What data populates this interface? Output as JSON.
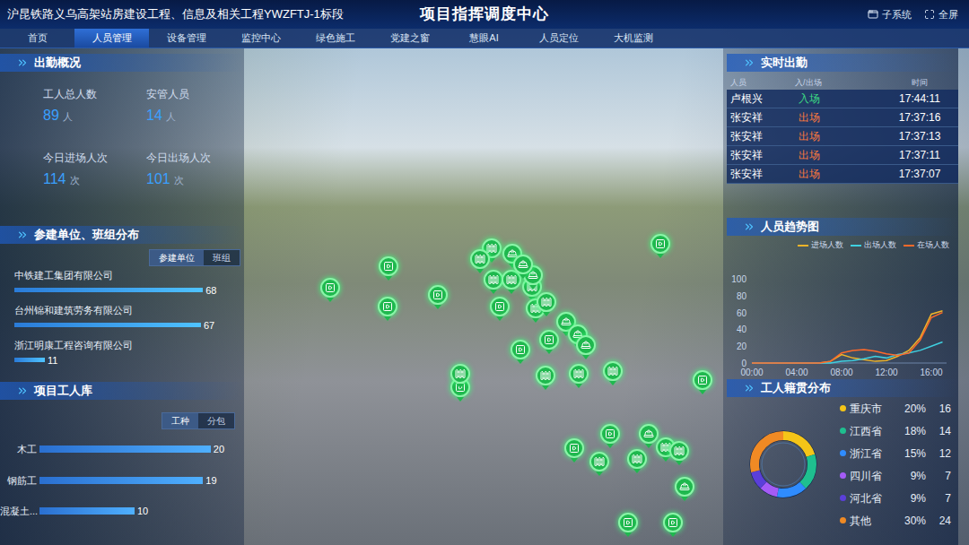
{
  "header": {
    "project": "沪昆铁路义乌高架站房建设工程、信息及相关工程YWZFTJ-1标段",
    "title": "项目指挥调度中心",
    "buttons": [
      {
        "label": "子系统",
        "kind": "subsystem"
      },
      {
        "label": "全屏",
        "kind": "fullscreen"
      }
    ]
  },
  "nav": [
    {
      "label": "首页",
      "selected": false
    },
    {
      "label": "人员管理",
      "selected": true
    },
    {
      "label": "设备管理",
      "selected": false
    },
    {
      "label": "监控中心",
      "selected": false
    },
    {
      "label": "绿色施工",
      "selected": false
    },
    {
      "label": "党建之窗",
      "selected": false
    },
    {
      "label": "慧眼AI",
      "selected": false
    },
    {
      "label": "人员定位",
      "selected": false
    },
    {
      "label": "大机监测",
      "selected": false
    }
  ],
  "attendance": {
    "title": "出勤概况",
    "stats": [
      {
        "label": "工人总人数",
        "value": "89",
        "unit": "人"
      },
      {
        "label": "安管人员",
        "value": "14",
        "unit": "人"
      },
      {
        "label": "今日进场人次",
        "value": "114",
        "unit": "次"
      },
      {
        "label": "今日出场人次",
        "value": "101",
        "unit": "次"
      }
    ]
  },
  "units": {
    "title": "参建单位、班组分布",
    "toggles": [
      {
        "label": "参建单位",
        "selected": true
      },
      {
        "label": "班组",
        "selected": false
      }
    ],
    "bars": [
      {
        "name": "中铁建工集团有限公司",
        "value": "68",
        "level": 0.93
      },
      {
        "name": "台州锦和建筑劳务有限公司",
        "value": "67",
        "level": 0.92
      },
      {
        "name": "浙江明康工程咨询有限公司",
        "value": "11",
        "level": 0.15
      }
    ]
  },
  "workers": {
    "title": "项目工人库",
    "toggles": [
      {
        "label": "工种",
        "selected": true
      },
      {
        "label": "分包",
        "selected": false
      }
    ],
    "bars": [
      {
        "name": "木工",
        "value": "20",
        "level": 0.9
      },
      {
        "name": "钢筋工",
        "value": "19",
        "level": 0.86
      },
      {
        "name": "混凝土...",
        "value": "10",
        "level": 0.5
      }
    ]
  },
  "realtime": {
    "title": "实时出勤",
    "columns": [
      "人员",
      "入/出场",
      "时间"
    ],
    "rows": [
      {
        "name": "卢根兴",
        "status": "入场",
        "time": "17:44:11",
        "color": "#3ddc84"
      },
      {
        "name": "张安祥",
        "status": "出场",
        "time": "17:37:16",
        "color": "#ff7a3c"
      },
      {
        "name": "张安祥",
        "status": "出场",
        "time": "17:37:13",
        "color": "#ff7a3c"
      },
      {
        "name": "张安祥",
        "status": "出场",
        "time": "17:37:11",
        "color": "#ff7a3c"
      },
      {
        "name": "张安祥",
        "status": "出场",
        "time": "17:37:07",
        "color": "#ff7a3c"
      }
    ]
  },
  "trend": {
    "title": "人员趋势图",
    "y_ticks": [
      "0",
      "20",
      "40",
      "60",
      "80",
      "100"
    ],
    "x_ticks": [
      "00:00",
      "04:00",
      "08:00",
      "12:00",
      "16:00"
    ],
    "series": [
      {
        "name": "进场人数",
        "color": "#f0b429",
        "values": [
          0,
          0,
          0,
          0,
          0,
          0,
          0,
          2,
          10,
          6,
          4,
          2,
          3,
          8,
          15,
          30,
          58,
          62
        ]
      },
      {
        "name": "出场人数",
        "color": "#3fd0e0",
        "values": [
          0,
          0,
          0,
          0,
          0,
          0,
          0,
          0,
          2,
          3,
          5,
          8,
          6,
          10,
          12,
          15,
          20,
          25
        ]
      },
      {
        "name": "在场人数",
        "color": "#ff6a2a",
        "values": [
          0,
          0,
          0,
          0,
          0,
          0,
          0,
          2,
          12,
          15,
          16,
          14,
          11,
          9,
          12,
          27,
          54,
          60
        ]
      }
    ]
  },
  "origin": {
    "title": "工人籍贯分布",
    "items": [
      {
        "name": "重庆市",
        "percent": "20%",
        "count": "16",
        "level": 0.2,
        "color": "#f5c518"
      },
      {
        "name": "江西省",
        "percent": "18%",
        "count": "14",
        "level": 0.18,
        "color": "#1fbf8f"
      },
      {
        "name": "浙江省",
        "percent": "15%",
        "count": "12",
        "level": 0.15,
        "color": "#2f8cff"
      },
      {
        "name": "四川省",
        "percent": "9%",
        "count": "7",
        "level": 0.09,
        "color": "#a55bf6"
      },
      {
        "name": "河北省",
        "percent": "9%",
        "count": "7",
        "level": 0.09,
        "color": "#5b3fd9"
      },
      {
        "name": "其他",
        "percent": "30%",
        "count": "24",
        "level": 0.3,
        "color": "#f08a24"
      }
    ]
  },
  "map": {
    "pins": [
      {
        "kind": "camera"
      },
      {
        "kind": "camera"
      },
      {
        "kind": "camera"
      },
      {
        "kind": "camera"
      },
      {
        "kind": "camera"
      },
      {
        "kind": "camera"
      },
      {
        "kind": "camera"
      },
      {
        "kind": "camera"
      },
      {
        "kind": "camera"
      },
      {
        "kind": "camera"
      },
      {
        "kind": "camera"
      },
      {
        "kind": "camera"
      },
      {
        "kind": "camera"
      },
      {
        "kind": "camera"
      },
      {
        "kind": "site"
      },
      {
        "kind": "site"
      },
      {
        "kind": "site"
      },
      {
        "kind": "site"
      },
      {
        "kind": "site"
      },
      {
        "kind": "site"
      },
      {
        "kind": "site"
      },
      {
        "kind": "site"
      },
      {
        "kind": "site"
      },
      {
        "kind": "site"
      },
      {
        "kind": "site"
      },
      {
        "kind": "site"
      },
      {
        "kind": "site"
      },
      {
        "kind": "site"
      },
      {
        "kind": "site"
      },
      {
        "kind": "worker"
      },
      {
        "kind": "worker"
      },
      {
        "kind": "worker"
      },
      {
        "kind": "worker"
      },
      {
        "kind": "worker"
      },
      {
        "kind": "worker"
      },
      {
        "kind": "worker"
      },
      {
        "kind": "worker"
      }
    ]
  }
}
